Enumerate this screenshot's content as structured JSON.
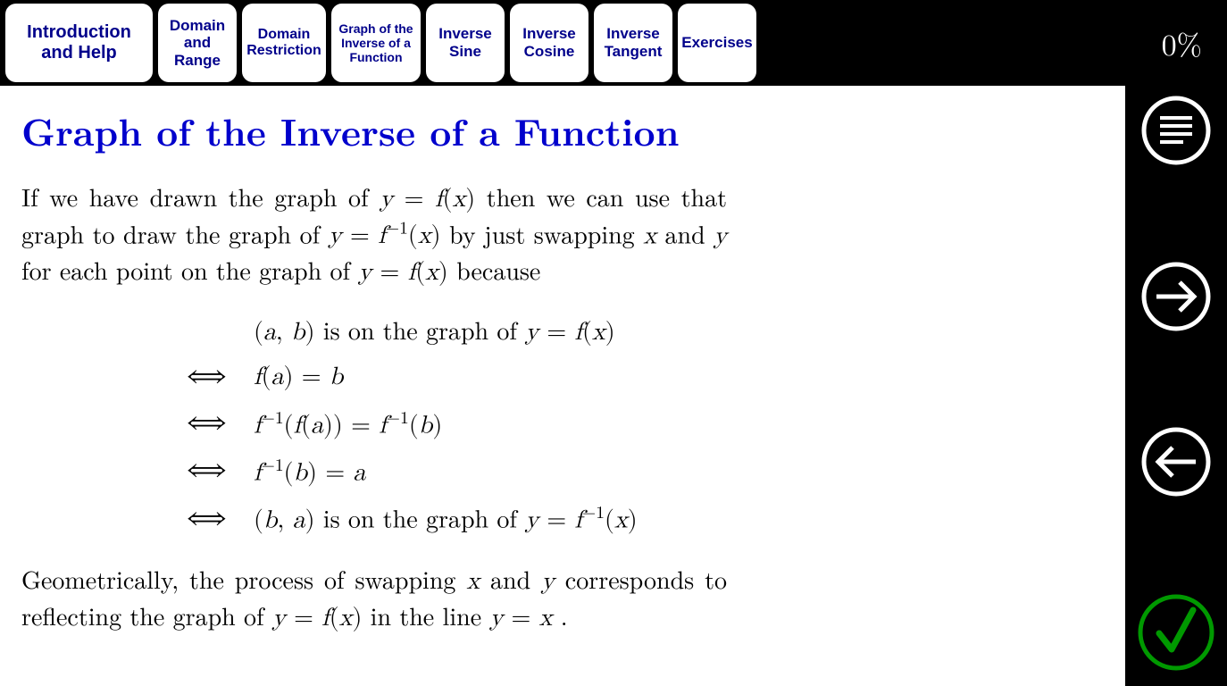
{
  "tabs": [
    {
      "label": "Introduction and Help"
    },
    {
      "label": "Domain and Range"
    },
    {
      "label": "Domain Restriction"
    },
    {
      "label": "Graph of the Inverse of a Function"
    },
    {
      "label": "Inverse Sine"
    },
    {
      "label": "Inverse Cosine"
    },
    {
      "label": "Inverse Tangent"
    },
    {
      "label": "Exercises"
    }
  ],
  "progress": "0%",
  "page": {
    "title": "Graph of the Inverse of a Function",
    "para1_prefix": "If we have drawn the graph of ",
    "para1_eq1": "y = f(x)",
    "para1_mid1": " then we can use that graph to draw the graph of ",
    "para1_eq2": "y = f⁻¹(x)",
    "para1_mid2": " by just swapping ",
    "para1_x": "x",
    "para1_and": " and ",
    "para1_y": "y",
    "para1_mid3": " for each point on the graph of ",
    "para1_eq3": "y = f(x)",
    "para1_suffix": " because",
    "line1_a": "(a, b)",
    "line1_mid": " is on the graph of ",
    "line1_b": "y = f(x)",
    "iff": "⟺",
    "line2": "f(a) = b",
    "line3": "f⁻¹(f(a)) = f⁻¹(b)",
    "line4": "f⁻¹(b) = a",
    "line5_a": "(b, a)",
    "line5_mid": " is on the graph of ",
    "line5_b": "y = f⁻¹(x)",
    "para2_prefix": "Geometrically, the process of swapping ",
    "para2_x": "x",
    "para2_and": " and ",
    "para2_y": "y",
    "para2_mid": " corresponds to reflecting the graph of ",
    "para2_eq1": "y = f(x)",
    "para2_mid2": " in the line ",
    "para2_eq2": "y = x",
    "para2_suffix": " ."
  },
  "sidebar": {
    "menu": "menu-icon",
    "next": "next-icon",
    "prev": "prev-icon",
    "check": "check-icon"
  }
}
